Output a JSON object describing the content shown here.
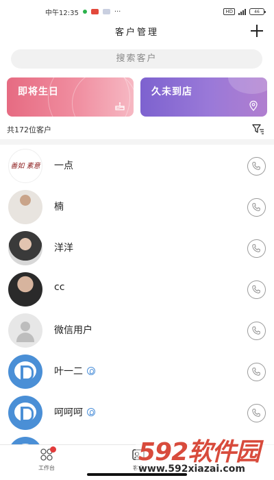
{
  "status_bar": {
    "time": "中午12:35",
    "more": "···",
    "network": "HD",
    "battery": "46"
  },
  "header": {
    "title": "客户管理"
  },
  "search": {
    "placeholder": "搜索客户"
  },
  "cards": [
    {
      "label": "即将生日",
      "icon": "cake-icon",
      "color_start": "#e66b82",
      "color_end": "#f6b8c3"
    },
    {
      "label": "久未到店",
      "icon": "location-pin-icon",
      "color_start": "#7d62cf",
      "color_end": "#b07ecf"
    }
  ],
  "summary": {
    "text": "共172位客户"
  },
  "customers": [
    {
      "name": "一点",
      "avatar": "calligraphy-avatar",
      "avatar_text": "善如 素意",
      "wechat": false
    },
    {
      "name": "楠",
      "avatar": "photo-avatar",
      "wechat": false
    },
    {
      "name": "洋洋",
      "avatar": "photo-avatar",
      "wechat": false
    },
    {
      "name": "cc",
      "avatar": "photo-avatar",
      "wechat": false
    },
    {
      "name": "微信用户",
      "avatar": "default-user-avatar",
      "wechat": false
    },
    {
      "name": "叶一二",
      "avatar": "app-logo-avatar",
      "wechat": true
    },
    {
      "name": "呵呵呵",
      "avatar": "app-logo-avatar",
      "wechat": true
    }
  ],
  "tabbar": {
    "tabs": [
      {
        "label": "工作台",
        "icon": "workbench-icon",
        "badge": true
      },
      {
        "label": "客户",
        "icon": "customer-icon",
        "badge": false
      }
    ]
  },
  "watermark": {
    "brand": "592软件园",
    "url": "www.592xiazai.com"
  },
  "colors": {
    "accent_pink": "#e66b82",
    "accent_purple": "#7d62cf",
    "badge_red": "#e23b3b",
    "watermark_red": "#d84b3c"
  }
}
